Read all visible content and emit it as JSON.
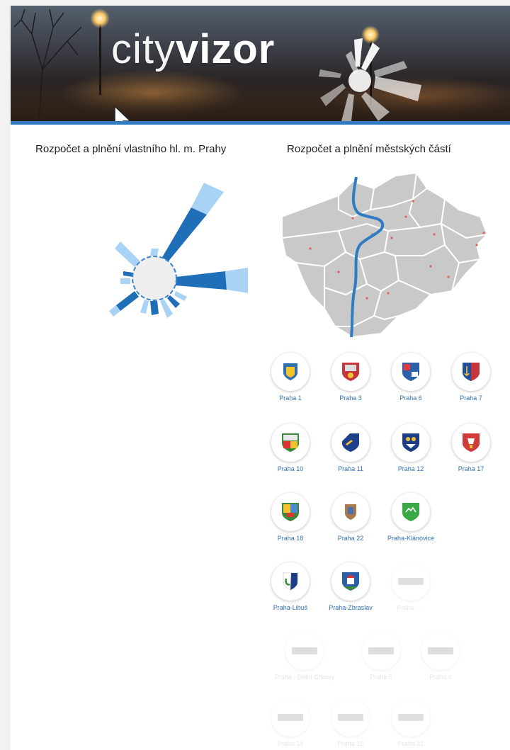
{
  "header": {
    "logo_light": "city",
    "logo_bold": "vizor"
  },
  "sections": {
    "left_title": "Rozpočet a plnění vlastního hl. m. Prahy",
    "right_title": "Rozpočet a plnění městských částí"
  },
  "colors": {
    "accent": "#2f7cc3",
    "dark_blue": "#1f6fb8",
    "light_blue": "#a9d3f5",
    "map_grey": "#c8c8c8",
    "river": "#2f7cc3",
    "link": "#2f6fb0"
  },
  "districts": [
    {
      "label": "Praha 1",
      "active": true
    },
    {
      "label": "Praha 3",
      "active": true
    },
    {
      "label": "Praha 6",
      "active": true
    },
    {
      "label": "Praha 7",
      "active": true
    },
    {
      "label": "Praha 10",
      "active": true
    },
    {
      "label": "Praha 11",
      "active": true
    },
    {
      "label": "Praha 12",
      "active": true
    },
    {
      "label": "Praha 17",
      "active": true
    },
    {
      "label": "Praha 18",
      "active": true
    },
    {
      "label": "Praha 22",
      "active": true
    },
    {
      "label": "Praha-Klánovice",
      "active": true
    },
    {
      "label": "Praha-Libuš",
      "active": true
    },
    {
      "label": "Praha-Zbraslav",
      "active": true
    },
    {
      "label": "Praha - ...",
      "active": false
    },
    {
      "label": "Praha - Dolní Chabry",
      "active": false
    },
    {
      "label": "Praha 5",
      "active": false
    },
    {
      "label": "Praha 4",
      "active": false
    },
    {
      "label": "Praha 14",
      "active": false
    },
    {
      "label": "Praha 15",
      "active": false
    },
    {
      "label": "Praha 21",
      "active": false
    }
  ]
}
